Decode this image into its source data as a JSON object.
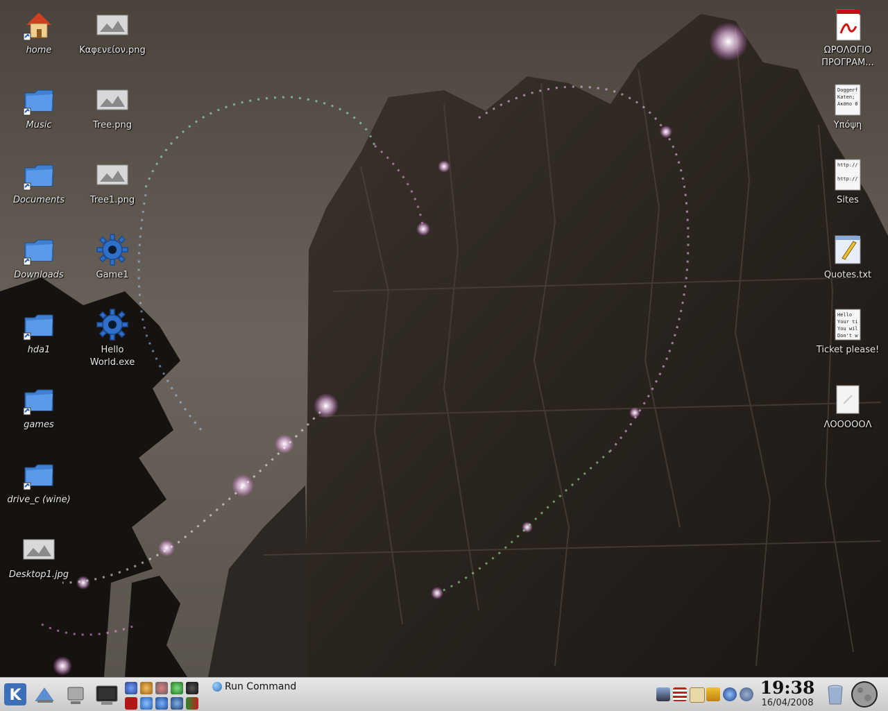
{
  "desktop": {
    "left_column": [
      {
        "label": "home",
        "icon": "home-folder-icon"
      },
      {
        "label": "Music",
        "icon": "folder-link-icon"
      },
      {
        "label": "Documents",
        "icon": "folder-link-icon"
      },
      {
        "label": "Downloads",
        "icon": "folder-link-icon"
      },
      {
        "label": "hda1",
        "icon": "folder-link-icon"
      },
      {
        "label": "games",
        "icon": "folder-link-icon"
      },
      {
        "label": "drive_c (wine)",
        "icon": "folder-link-icon"
      },
      {
        "label": "Desktop1.jpg",
        "icon": "image-thumbnail-icon"
      }
    ],
    "second_column": [
      {
        "label": "Καφενείον.png",
        "icon": "image-thumbnail-icon"
      },
      {
        "label": "Tree.png",
        "icon": "image-thumbnail-icon"
      },
      {
        "label": "Tree1.png",
        "icon": "image-thumbnail-icon"
      },
      {
        "label": "Game1",
        "icon": "gear-executable-icon"
      },
      {
        "label": "Hello World.exe",
        "icon": "gear-executable-icon"
      }
    ],
    "right_column": [
      {
        "label": "ΩΡΟΛΟΓΙΟ ΠΡΟΓΡΑΜ...",
        "icon": "pdf-file-icon"
      },
      {
        "label": "Υπόψη",
        "icon": "text-file-icon",
        "preview": "Doggerf\nKaten;\nΑκσπο θ"
      },
      {
        "label": "Sites",
        "icon": "text-file-icon",
        "preview": "http://\n\nhttp://"
      },
      {
        "label": "Quotes.txt",
        "icon": "text-edit-file-icon"
      },
      {
        "label": "Ticket please!",
        "icon": "text-file-icon",
        "preview": "Hello\nYour ti\nYou wil\nDon't w"
      },
      {
        "label": "ΛΟΟΟΟΟΛ",
        "icon": "blank-text-file-icon"
      }
    ]
  },
  "taskbar": {
    "run_command_label": "Run Command",
    "clock_time": "19:38",
    "clock_date": "16/04/2008",
    "quicklaunch": [
      "kde-menu-icon",
      "desktop-icon",
      "system-icon",
      "terminal-icon"
    ],
    "applets_top": [
      "firefox-icon",
      "gimp-icon",
      "network-icon",
      "messenger-icon",
      "gnome-foot-icon"
    ],
    "applets_bottom": [
      "filezilla-icon",
      "globe-icon",
      "network-share-icon",
      "browser-icon",
      "flag-icon"
    ],
    "tray": [
      "display-icon",
      "us-flag-keyboard-icon",
      "klipper-icon",
      "warning-icon",
      "clock-applet-icon",
      "user-icon"
    ],
    "trash_icon": "trash-icon",
    "moon_icon": "moon-phase-icon"
  },
  "colors": {
    "label_text": "#e8e8e8",
    "taskbar_bg": "#d8d8d8",
    "folder_blue": "#3f7fd4"
  }
}
